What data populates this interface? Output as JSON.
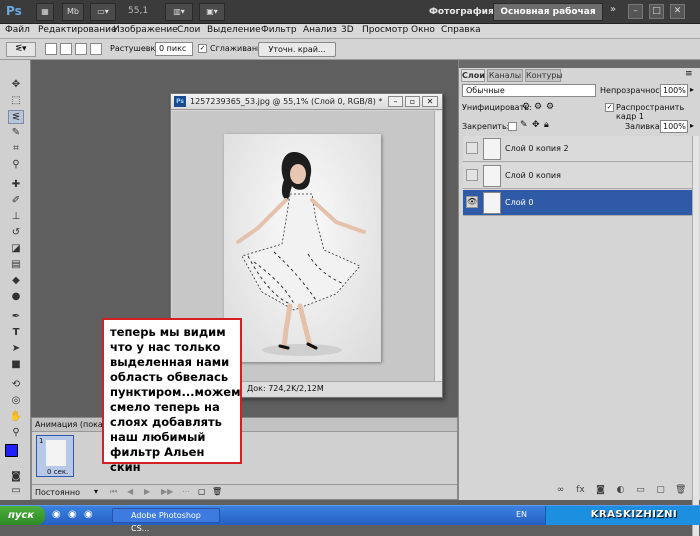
{
  "appbar": {
    "logo": "Ps",
    "mb_label": "Mb",
    "zoom": "55,1",
    "workspace_photo": "Фотография",
    "workspace_main": "Основная рабочая среда",
    "more_arrow": "»",
    "win_min": "–",
    "win_max": "□",
    "win_close": "✕"
  },
  "menu": [
    "Файл",
    "Редактирование",
    "Изображение",
    "Слои",
    "Выделение",
    "Фильтр",
    "Анализ",
    "3D",
    "Просмотр",
    "Окно",
    "Справка"
  ],
  "options": {
    "feather_label": "Растушевка:",
    "feather_value": "0 пикс",
    "antialias_label": "Сглаживание",
    "refine_button": "Уточн. край..."
  },
  "document": {
    "title": "1257239365_53.jpg @ 55,1% (Слой 0, RGB/8) *",
    "status": "Док: 724,2K/2,12M"
  },
  "panel": {
    "tabs": [
      "Слои",
      "Каналы",
      "Контуры"
    ],
    "blend_mode": "Обычные",
    "opacity_label": "Непрозрачность:",
    "opacity_value": "100%",
    "unify_label": "Унифицировать:",
    "propagate_label": "Распространить кадр 1",
    "lock_label": "Закрепить:",
    "fill_label": "Заливка:",
    "fill_value": "100%",
    "layers": [
      {
        "name": "Слой 0 копия 2",
        "selected": false
      },
      {
        "name": "Слой 0 копия",
        "selected": false
      },
      {
        "name": "Слой 0",
        "selected": true
      }
    ]
  },
  "animation": {
    "title": "Анимация (покадровая)",
    "frame_number": "1",
    "frame_time": "0 сек.",
    "loop": "Постоянно"
  },
  "note": {
    "text": "теперь мы видим что у нас только выделенная нами область обвелась пунктиром...можем смело теперь на слоях добавлять наш любимый фильтр Альен скин"
  },
  "taskbar": {
    "start": "пуск",
    "item": "Adobe Photoshop CS...",
    "lang": "EN",
    "brand": "KRASKIZHIZNI"
  },
  "colors": {
    "foreground": "#2020ff",
    "background": "#ffffff",
    "accent": "#2f5aa8",
    "note_border": "#d32020"
  }
}
